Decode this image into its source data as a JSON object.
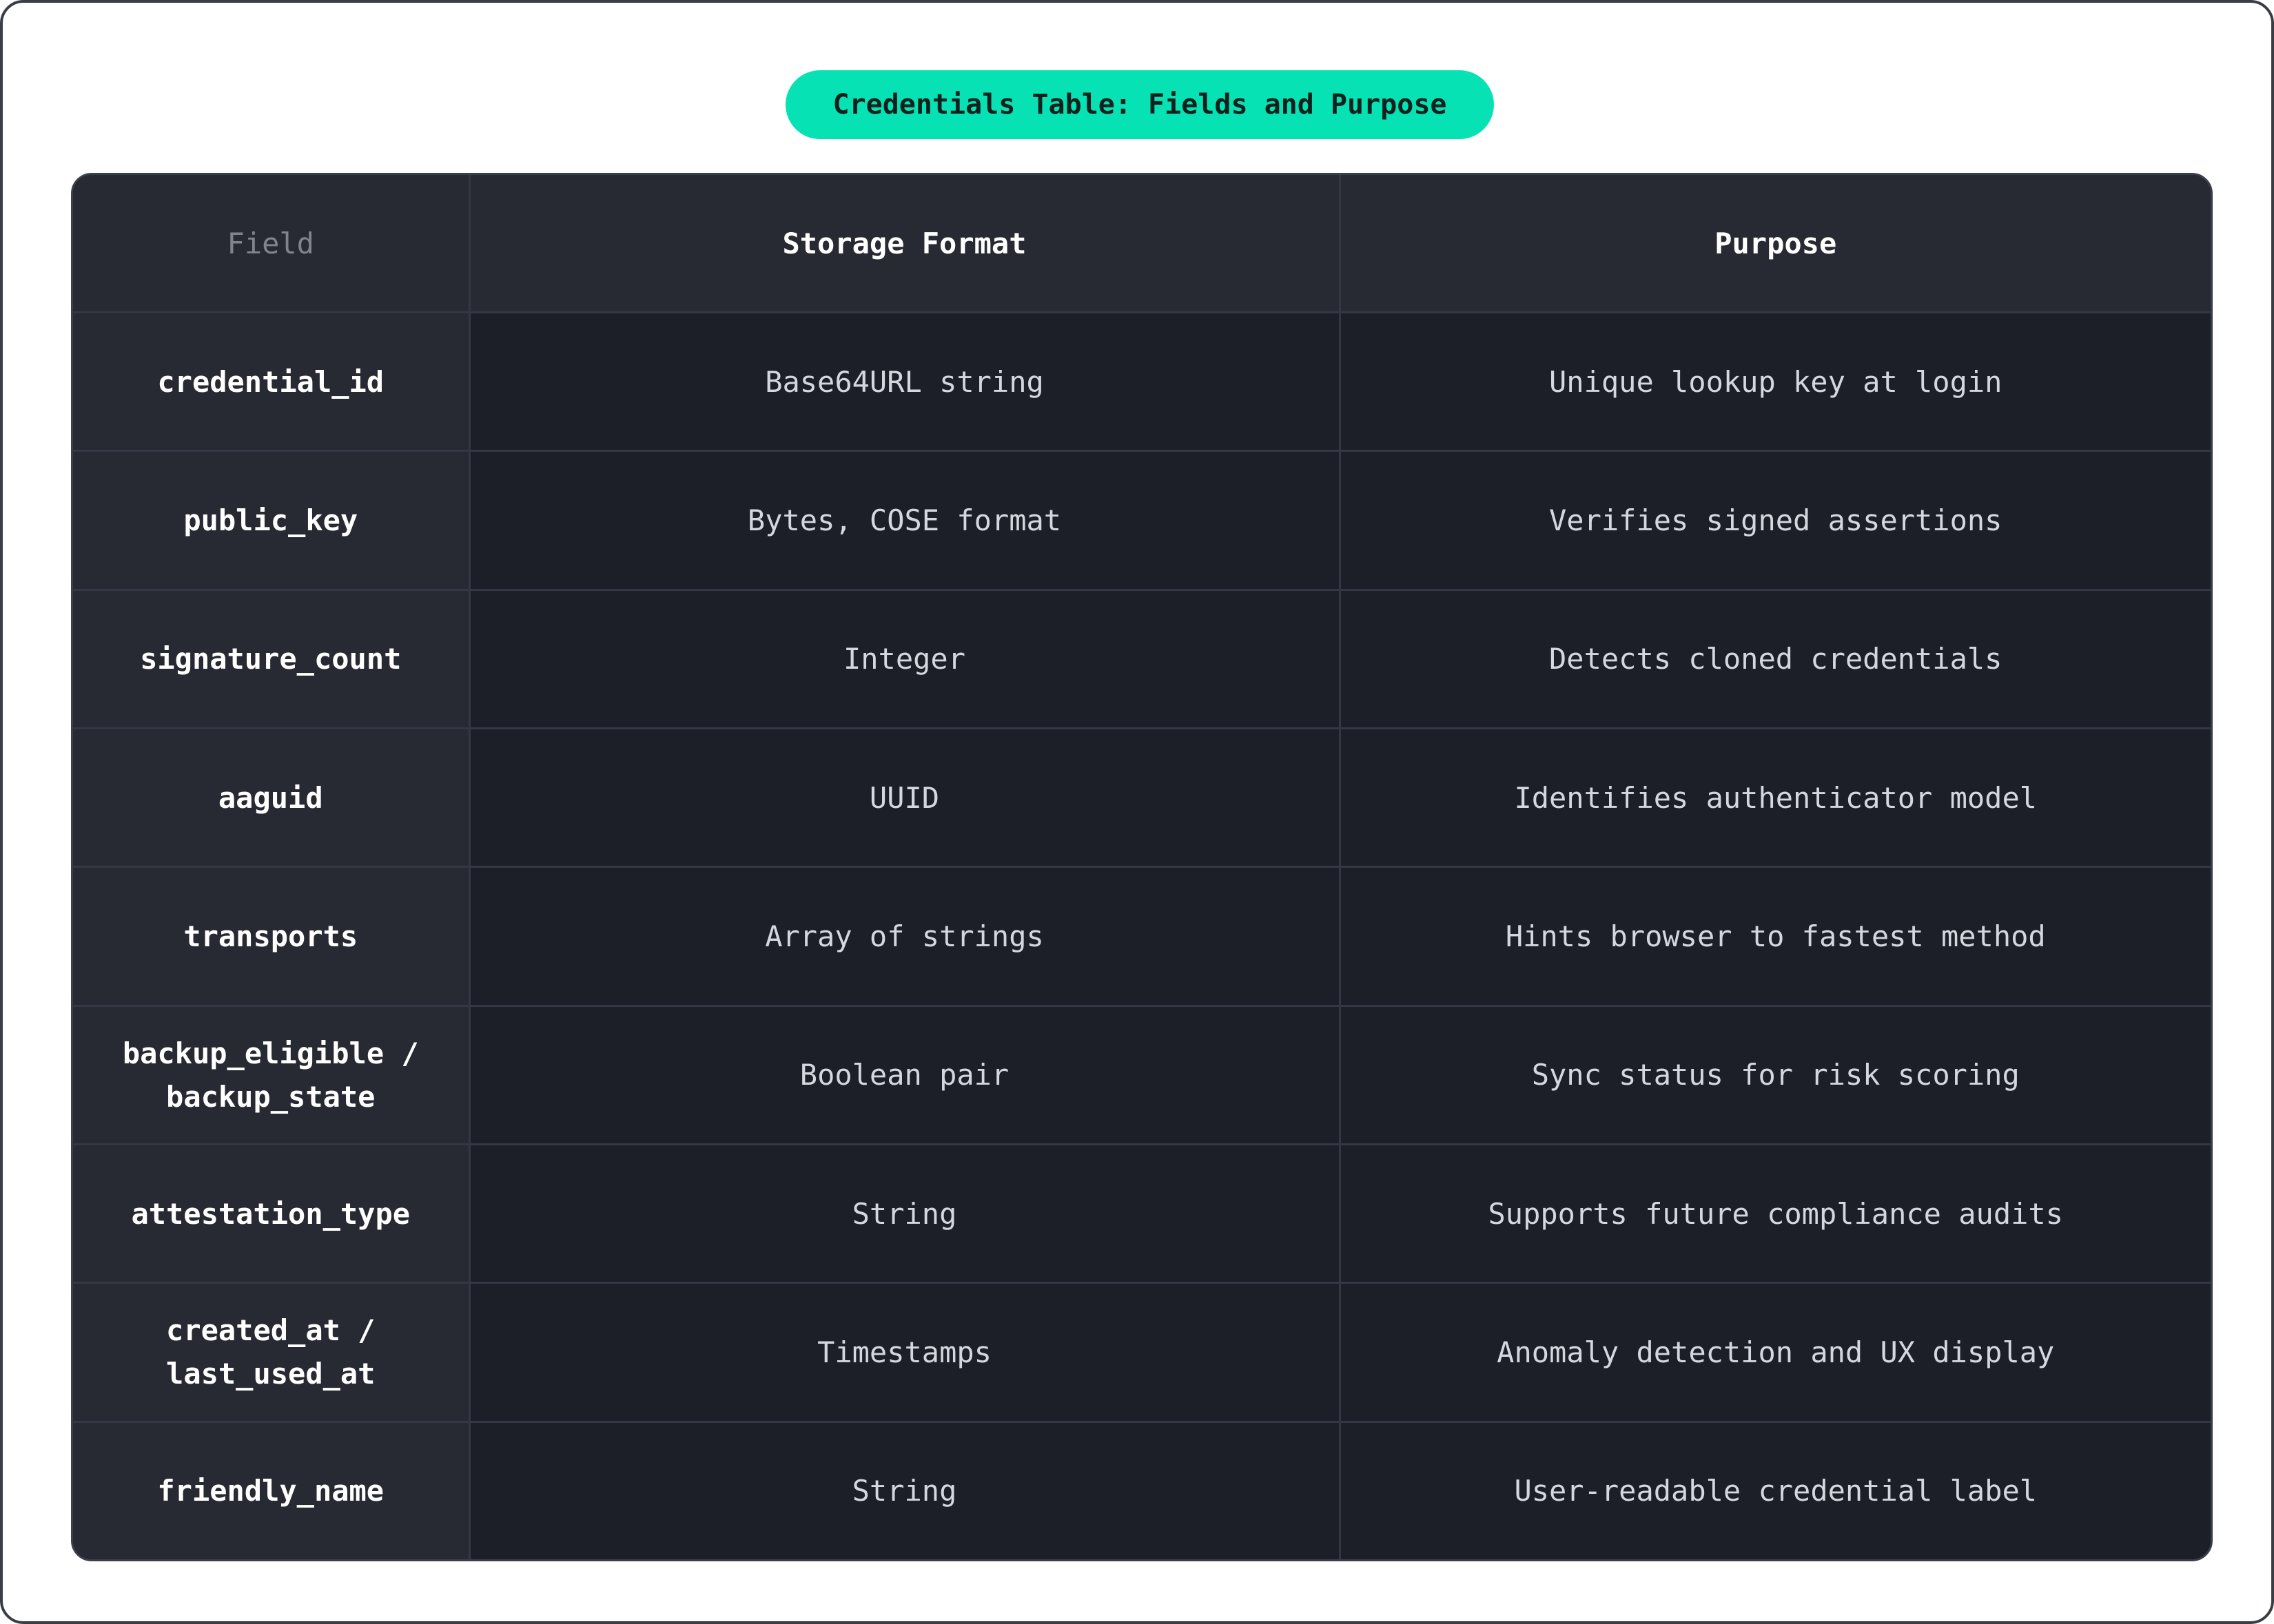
{
  "title": "Credentials Table: Fields and Purpose",
  "colors": {
    "accent": "#06e2b4",
    "table_bg": "#1c1f28",
    "header_bg": "#272a33"
  },
  "table": {
    "headers": [
      "Field",
      "Storage Format",
      "Purpose"
    ],
    "rows": [
      {
        "field": "credential_id",
        "format": "Base64URL string",
        "purpose": "Unique lookup key at login"
      },
      {
        "field": "public_key",
        "format": "Bytes, COSE format",
        "purpose": "Verifies signed assertions"
      },
      {
        "field": "signature_count",
        "format": "Integer",
        "purpose": "Detects cloned credentials"
      },
      {
        "field": "aaguid",
        "format": "UUID",
        "purpose": "Identifies authenticator model"
      },
      {
        "field": "transports",
        "format": "Array of strings",
        "purpose": "Hints browser to fastest method"
      },
      {
        "field": "backup_eligible / backup_state",
        "format": "Boolean pair",
        "purpose": "Sync status for risk scoring"
      },
      {
        "field": "attestation_type",
        "format": "String",
        "purpose": "Supports future compliance audits"
      },
      {
        "field": "created_at / last_used_at",
        "format": "Timestamps",
        "purpose": "Anomaly detection and UX display"
      },
      {
        "field": "friendly_name",
        "format": "String",
        "purpose": "User-readable credential label"
      }
    ]
  }
}
